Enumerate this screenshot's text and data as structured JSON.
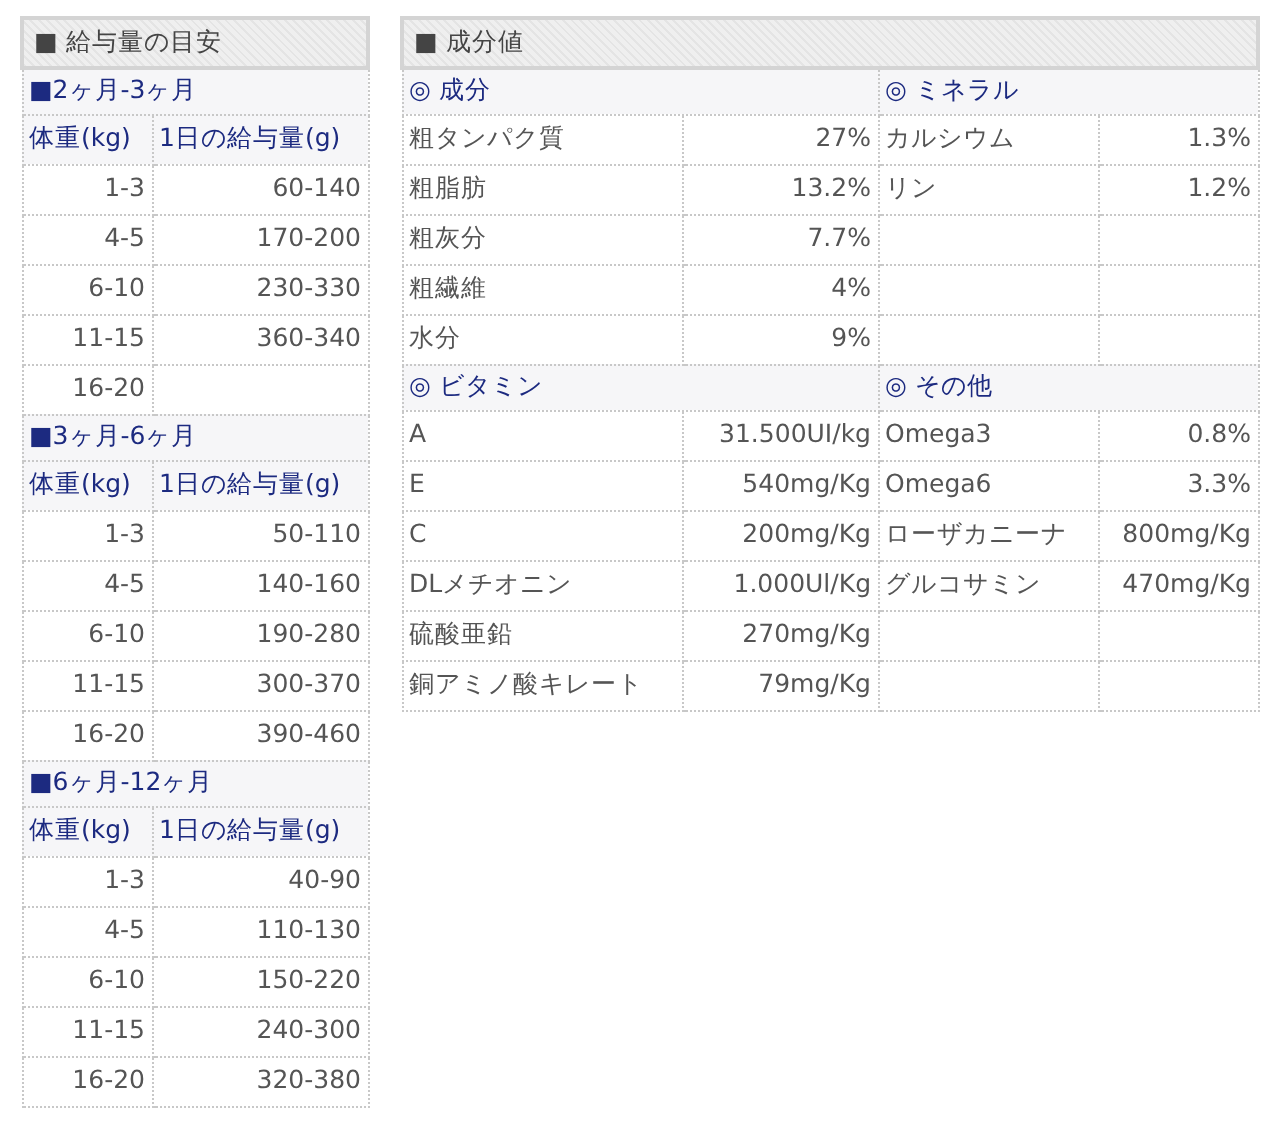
{
  "feeding_guide": {
    "title": "■ 給与量の目安",
    "sections": [
      {
        "title": "■2ヶ月-3ヶ月",
        "columns": [
          "体重(kg)",
          "1日の給与量(g)"
        ],
        "rows": [
          {
            "weight": "1-3",
            "amount": "60-140"
          },
          {
            "weight": "4-5",
            "amount": "170-200"
          },
          {
            "weight": "6-10",
            "amount": "230-330"
          },
          {
            "weight": "11-15",
            "amount": "360-340"
          },
          {
            "weight": "16-20"
          }
        ]
      },
      {
        "title": "■3ヶ月-6ヶ月",
        "columns": [
          "体重(kg)",
          "1日の給与量(g)"
        ],
        "rows": [
          {
            "weight": "1-3",
            "amount": "50-110"
          },
          {
            "weight": "4-5",
            "amount": "140-160"
          },
          {
            "weight": "6-10",
            "amount": "190-280"
          },
          {
            "weight": "11-15",
            "amount": "300-370"
          },
          {
            "weight": "16-20",
            "amount": "390-460"
          }
        ]
      },
      {
        "title": "■6ヶ月-12ヶ月",
        "columns": [
          "体重(kg)",
          "1日の給与量(g)"
        ],
        "rows": [
          {
            "weight": "1-3",
            "amount": "40-90"
          },
          {
            "weight": "4-5",
            "amount": "110-130"
          },
          {
            "weight": "6-10",
            "amount": "150-220"
          },
          {
            "weight": "11-15",
            "amount": "240-300"
          },
          {
            "weight": "16-20",
            "amount": "320-380"
          }
        ]
      }
    ]
  },
  "composition": {
    "title": "■ 成分値",
    "blocks": [
      {
        "headings": [
          "◎ 成分",
          "◎ ミネラル"
        ],
        "rows": [
          {
            "left": {
              "name": "粗タンパク質",
              "value": "27%"
            },
            "right": {
              "name": "カルシウム",
              "value": "1.3%"
            }
          },
          {
            "left": {
              "name": "粗脂肪",
              "value": "13.2%"
            },
            "right": {
              "name": "リン",
              "value": "1.2%"
            }
          },
          {
            "left": {
              "name": "粗灰分",
              "value": "7.7%"
            }
          },
          {
            "left": {
              "name": "粗繊維",
              "value": "4%"
            }
          },
          {
            "left": {
              "name": "水分",
              "value": "9%"
            }
          }
        ]
      },
      {
        "headings": [
          "◎ ビタミン",
          "◎ その他"
        ],
        "rows": [
          {
            "left": {
              "name": "A",
              "value": "31.500UI/kg"
            },
            "right": {
              "name": "Omega3",
              "value": "0.8%"
            }
          },
          {
            "left": {
              "name": "E",
              "value": "540mg/Kg"
            },
            "right": {
              "name": "Omega6",
              "value": "3.3%"
            }
          },
          {
            "left": {
              "name": "C",
              "value": "200mg/Kg"
            },
            "right": {
              "name": "ローザカニーナ",
              "value": "800mg/Kg"
            }
          },
          {
            "left": {
              "name": "DLメチオニン",
              "value": "1.000Ul/Kg"
            },
            "right": {
              "name": "グルコサミン",
              "value": "470mg/Kg"
            }
          },
          {
            "left": {
              "name": "硫酸亜鉛",
              "value": "270mg/Kg"
            }
          },
          {
            "left": {
              "name": "銅アミノ酸キレート",
              "value": "79mg/Kg"
            }
          }
        ]
      }
    ]
  }
}
